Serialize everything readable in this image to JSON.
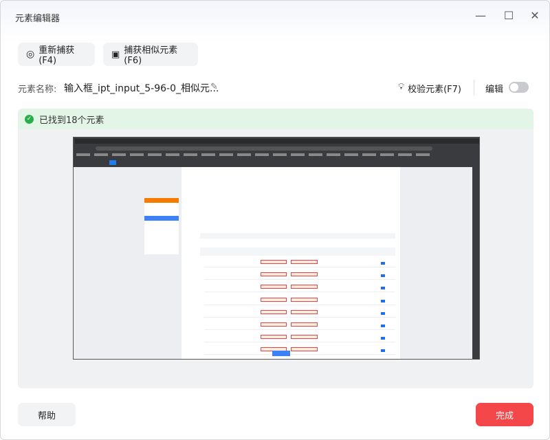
{
  "window": {
    "title": "元素编辑器",
    "minimize": "—",
    "maximize": "☐",
    "close": "✕"
  },
  "toolbar": {
    "recapture": "重新捕获(F4)",
    "capture_similar": "捕获相似元素(F6)"
  },
  "element": {
    "name_label": "元素名称:",
    "name_value": "输入框_ipt_input_5-96-0_相似元...",
    "validate": "校验元素(F7)",
    "edit_label": "编辑",
    "edit_on": false
  },
  "status": {
    "text": "已找到18个元素",
    "color": "#2aae4a"
  },
  "footer": {
    "help": "帮助",
    "done": "完成",
    "done_color": "#f4474a"
  }
}
